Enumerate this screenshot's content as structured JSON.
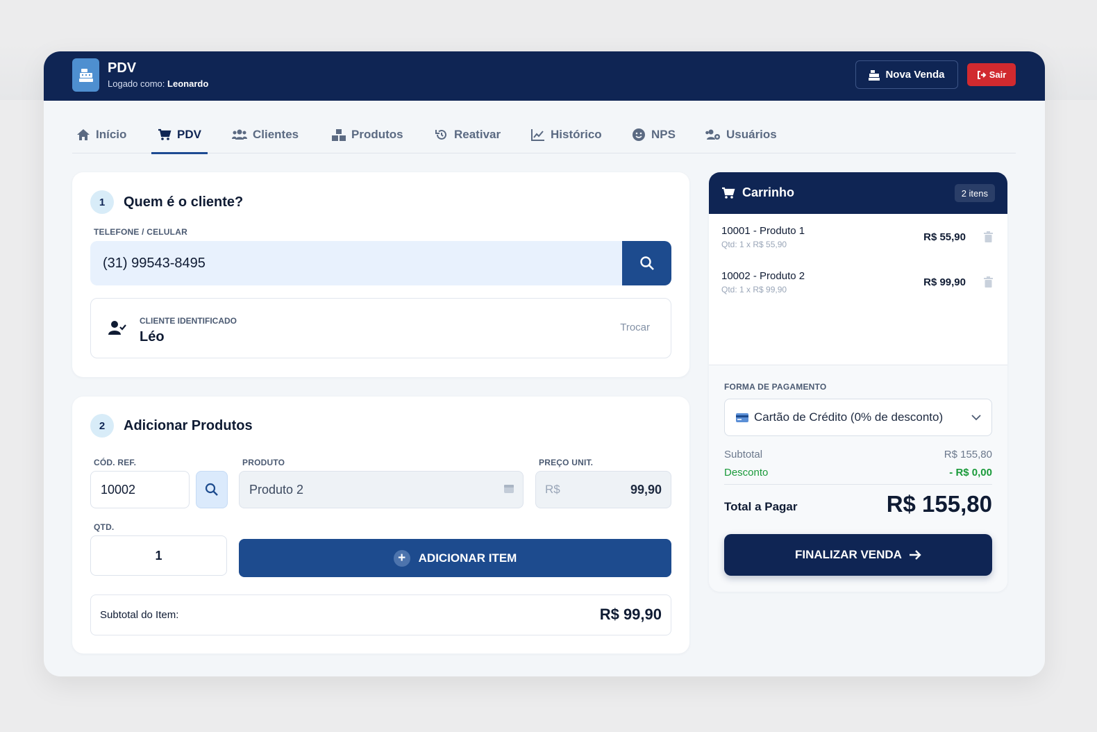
{
  "header": {
    "app_title": "PDV",
    "logged_as_prefix": "Logado como:",
    "user_name": "Leonardo",
    "new_sale_label": "Nova Venda",
    "logout_label": "Sair"
  },
  "nav": {
    "items": [
      {
        "label": "Início",
        "icon": "home-icon"
      },
      {
        "label": "PDV",
        "icon": "cart-icon",
        "active": true
      },
      {
        "label": "Clientes",
        "icon": "users-icon"
      },
      {
        "label": "Produtos",
        "icon": "boxes-icon"
      },
      {
        "label": "Reativar",
        "icon": "history-icon"
      },
      {
        "label": "Histórico",
        "icon": "chart-line-icon"
      },
      {
        "label": "NPS",
        "icon": "smile-icon"
      },
      {
        "label": "Usuários",
        "icon": "users-cog-icon"
      }
    ]
  },
  "client_step": {
    "number": "1",
    "title": "Quem é o cliente?",
    "phone_label": "TELEFONE / CELULAR",
    "phone_value": "(31) 99543-8495",
    "identified_label": "CLIENTE IDENTIFICADO",
    "client_name": "Léo",
    "change_label": "Trocar"
  },
  "product_step": {
    "number": "2",
    "title": "Adicionar Produtos",
    "ref_label": "CÓD. REF.",
    "ref_value": "10002",
    "product_label": "PRODUTO",
    "product_value": "Produto 2",
    "price_label": "PREÇO UNIT.",
    "price_currency": "R$",
    "price_value": "99,90",
    "qty_label": "QTD.",
    "qty_value": "1",
    "add_button_label": "ADICIONAR ITEM",
    "item_subtotal_label": "Subtotal do Item:",
    "item_subtotal_value": "R$ 99,90"
  },
  "cart": {
    "title": "Carrinho",
    "count_label": "2 itens",
    "items": [
      {
        "name": "10001 - Produto 1",
        "detail": "Qtd: 1 x R$ 55,90",
        "price": "R$ 55,90"
      },
      {
        "name": "10002 - Produto 2",
        "detail": "Qtd: 1 x R$ 99,90",
        "price": "R$ 99,90"
      }
    ],
    "payment_label": "FORMA DE PAGAMENTO",
    "payment_value": "Cartão de Crédito (0% de desconto)",
    "subtotal_label": "Subtotal",
    "subtotal_value": "R$ 155,80",
    "discount_label": "Desconto",
    "discount_value": "- R$ 0,00",
    "total_label": "Total a Pagar",
    "total_value": "R$ 155,80",
    "finalize_label": "FINALIZAR VENDA"
  },
  "colors": {
    "brand_navy": "#0f2554",
    "primary_blue": "#1d4b8e",
    "danger": "#d12a2f",
    "success": "#1a9a3a"
  }
}
